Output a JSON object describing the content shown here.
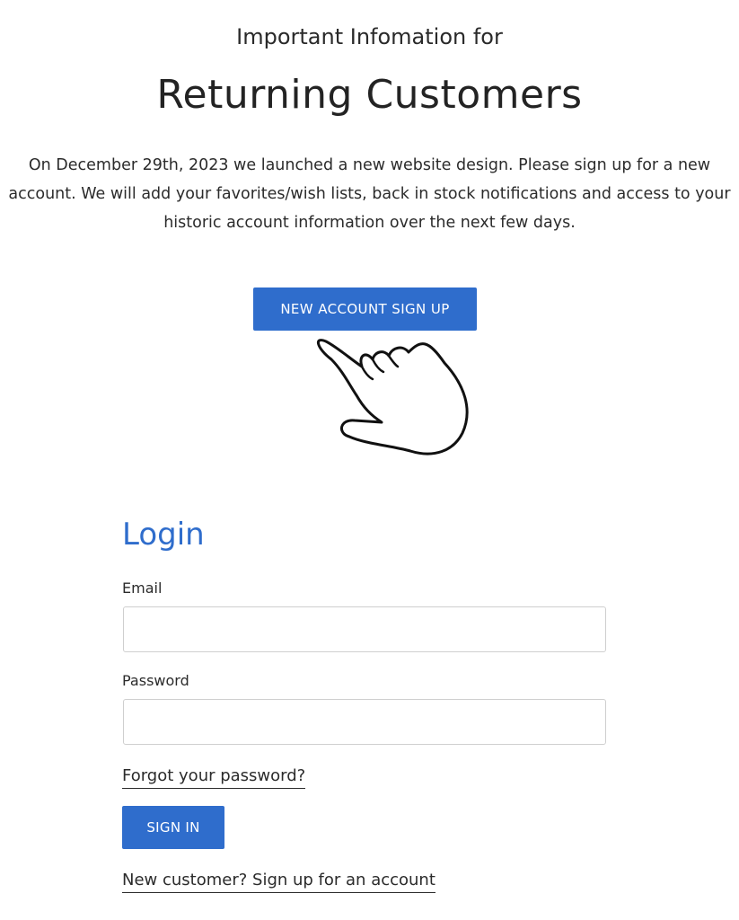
{
  "notice": {
    "subtitle": "Important Infomation for",
    "title": "Returning Customers",
    "body": "On December 29th, 2023 we launched a new website design. Please sign up for a new account. We will add your favorites/wish lists, back in stock notifications and access to your historic account information over the next few days.",
    "signup_button_label": "NEW ACCOUNT SIGN UP",
    "pointer_icon": "pointing-hand-icon"
  },
  "login": {
    "heading": "Login",
    "email_label": "Email",
    "email_value": "",
    "password_label": "Password",
    "password_value": "",
    "forgot_link": "Forgot your password?",
    "signin_button_label": "SIGN IN",
    "new_customer_link": "New customer? Sign up for an account"
  },
  "colors": {
    "accent": "#2f6dcc",
    "text": "#2b2b2b",
    "button_text": "#ffffff",
    "input_border": "#cfcfcf"
  }
}
